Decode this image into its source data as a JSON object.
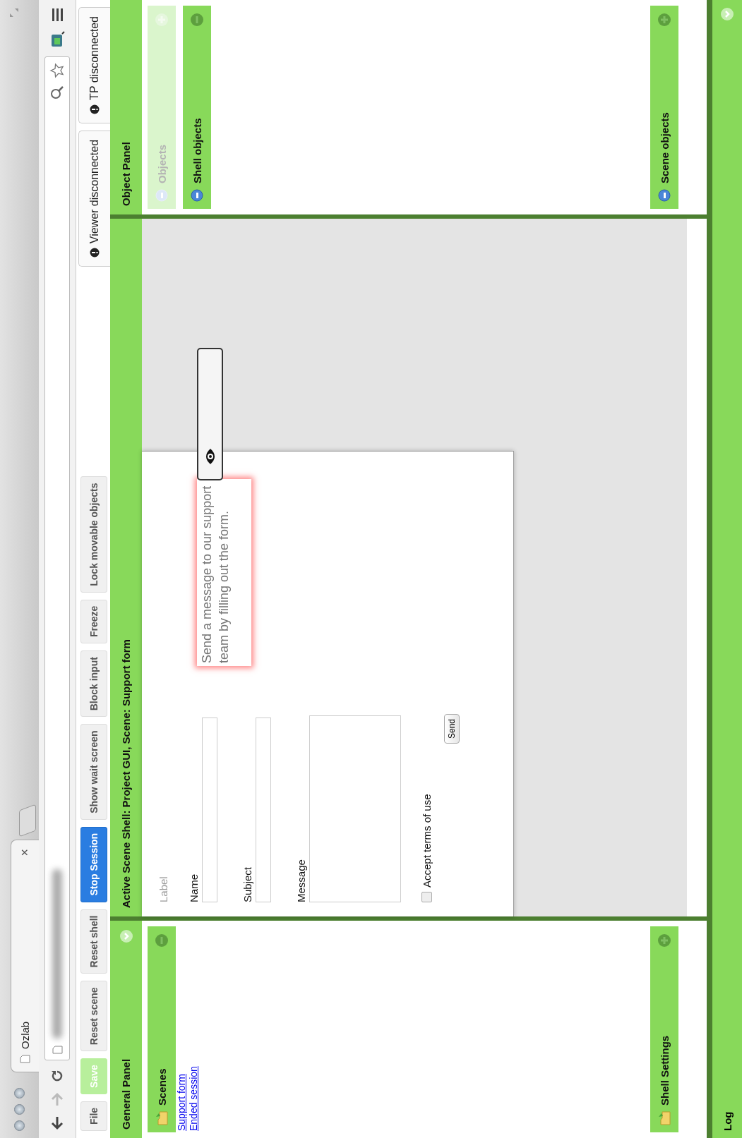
{
  "browser": {
    "tab": {
      "title": "Ozlab",
      "close": "×"
    }
  },
  "toolbar": {
    "buttons": [
      {
        "label": "File",
        "kind": "menu",
        "disabled": false
      },
      {
        "label": "Save",
        "kind": "action",
        "disabled": true
      },
      {
        "label": "Reset scene",
        "kind": "action",
        "disabled": false
      },
      {
        "label": "Reset shell",
        "kind": "action",
        "disabled": false
      },
      {
        "label": "Stop Session",
        "kind": "primary",
        "disabled": false
      },
      {
        "label": "Show wait screen",
        "kind": "action",
        "disabled": false
      },
      {
        "label": "Block input",
        "kind": "action",
        "disabled": false
      },
      {
        "label": "Freeze",
        "kind": "action",
        "disabled": false
      },
      {
        "label": "Lock movable objects",
        "kind": "action",
        "disabled": false
      }
    ],
    "status": [
      {
        "label": "Viewer disconnected"
      },
      {
        "label": "TP disconnected"
      }
    ]
  },
  "general_panel": {
    "title": "General Panel",
    "top_sections": [
      {
        "title": "Scenes",
        "kind": "folder",
        "expanded": true,
        "disabled": false,
        "links": [
          "Support form",
          "Ended session"
        ]
      }
    ],
    "bottom_sections": [
      {
        "title": "Shell Settings",
        "kind": "folder",
        "expanded": false,
        "disabled": false
      }
    ]
  },
  "scene_area": {
    "title": "Active Scene Shell: Project GUI, Scene: Support form",
    "form": {
      "label": "Label",
      "fields": [
        {
          "label": "Name",
          "kind": "text"
        },
        {
          "label": "Subject",
          "kind": "text"
        },
        {
          "label": "Message",
          "kind": "textarea"
        }
      ],
      "checkbox": {
        "label": "Accept terms of use",
        "checked": false
      },
      "button": "Send",
      "tooltip": "Send a message to our support team by filling out the form."
    }
  },
  "object_panel": {
    "title": "Object Panel",
    "top_sections": [
      {
        "title": "Objects",
        "kind": "objects",
        "expanded": false,
        "disabled": true
      },
      {
        "title": "Shell objects",
        "kind": "objects",
        "expanded": true,
        "disabled": false
      }
    ],
    "bottom_sections": [
      {
        "title": "Scene objects",
        "kind": "objects",
        "expanded": false,
        "disabled": false
      }
    ]
  },
  "log": {
    "title": "Log"
  }
}
